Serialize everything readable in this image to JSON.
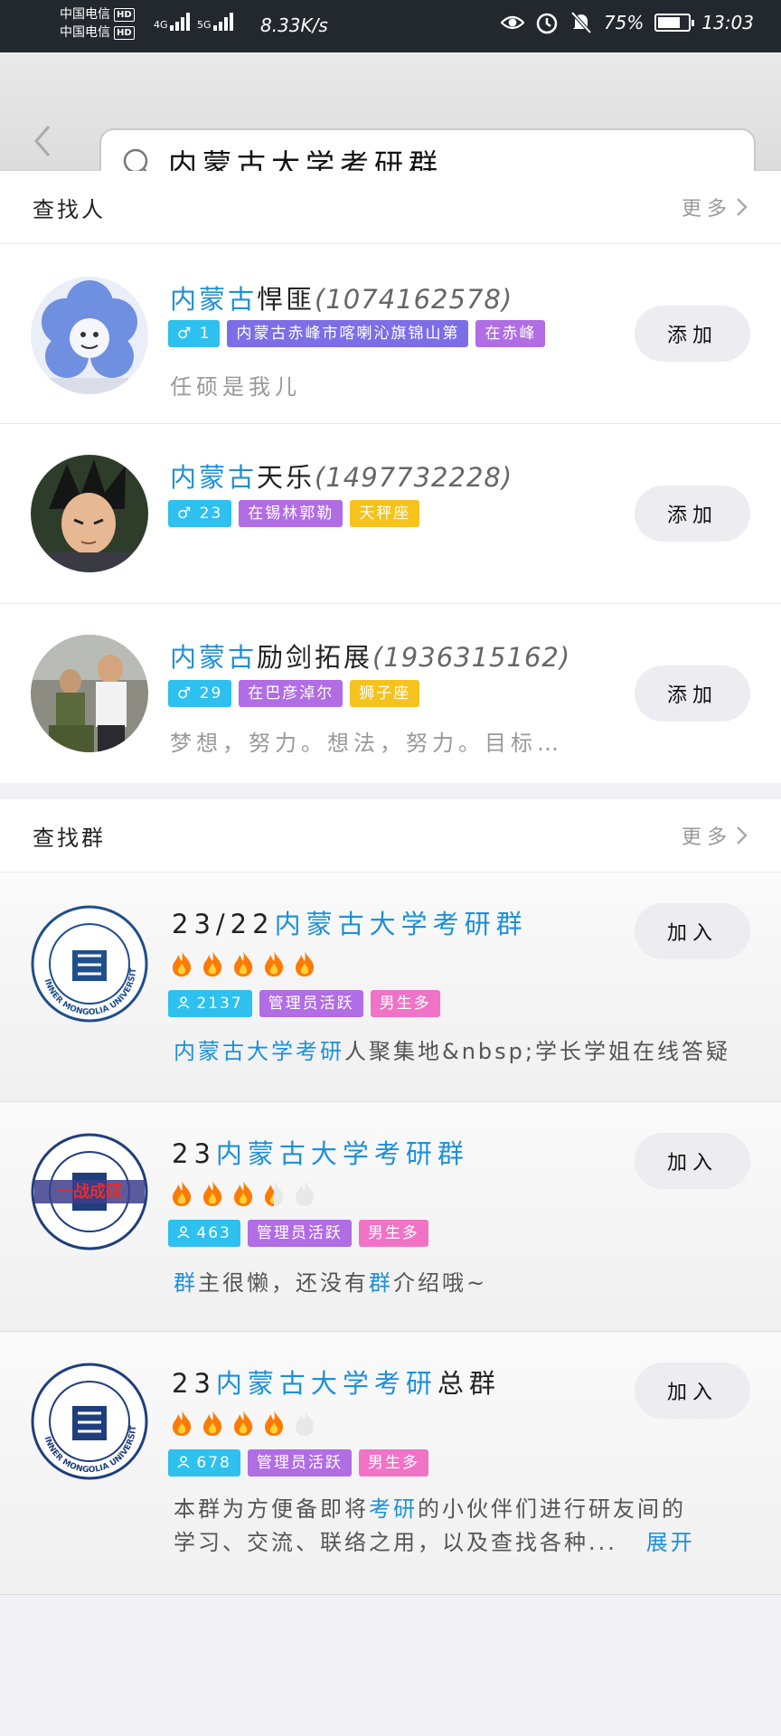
{
  "status": {
    "carrier1": "中国电信",
    "carrier2": "中国电信",
    "hd": "HD",
    "net1": "4G",
    "net2": "5G",
    "speed": "8.33K/s",
    "battery": "75%",
    "battery_level": 0.75,
    "time": "13:03"
  },
  "search": {
    "query": "内蒙古大学考研群"
  },
  "people": {
    "title": "查找人",
    "more": "更多",
    "items": [
      {
        "name_hl": "内蒙古",
        "name_rest": "悍匪",
        "qq": "(1074162578)",
        "age": "1",
        "tags": [
          "内蒙古赤峰市喀喇沁旗锦山第",
          "在赤峰"
        ],
        "desc": "任硕是我儿",
        "button": "添加"
      },
      {
        "name_hl": "内蒙古",
        "name_rest": "天乐",
        "qq": "(1497732228)",
        "age": "23",
        "tags": [
          "在锡林郭勒",
          "天秤座"
        ],
        "desc": "",
        "button": "添加"
      },
      {
        "name_hl": "内蒙古",
        "name_rest": "励剑拓展",
        "qq": "(1936315162)",
        "age": "29",
        "tags": [
          "在巴彦淖尔",
          "狮子座"
        ],
        "desc": "梦想，努力。想法，努力。目标…",
        "button": "添加"
      }
    ]
  },
  "groups": {
    "title": "查找群",
    "more": "更多",
    "items": [
      {
        "prefix": "23/22",
        "name_hl": "内蒙古大学考研群",
        "suffix": "",
        "heat": 5,
        "members": "2137",
        "tag1": "管理员活跃",
        "tag2": "男生多",
        "desc_hl": "内蒙古大学考研",
        "desc_rest": "人聚集地&nbsp;学长学姐在线答疑",
        "button": "加入"
      },
      {
        "prefix": "23",
        "name_hl": "内蒙古大学考研群",
        "suffix": "",
        "heat": 3.5,
        "members": "463",
        "tag1": "管理员活跃",
        "tag2": "男生多",
        "desc_hl1": "群",
        "desc_mid": "主很懒，还没有",
        "desc_hl2": "群",
        "desc_rest": "介绍哦~",
        "logo_stamp": "一战成硕",
        "button": "加入"
      },
      {
        "prefix": "23",
        "name_hl": "内蒙古大学考研",
        "suffix": "总群",
        "heat": 4,
        "members": "678",
        "tag1": "管理员活跃",
        "tag2": "男生多",
        "desc_line1_a": "本群为方便备即将",
        "desc_line1_hl": "考研",
        "desc_line1_b": "的小伙伴们进行研友间的",
        "desc_line2": "学习、交流、联络之用，以及查找各种...",
        "expand": "展开",
        "button": "加入"
      }
    ],
    "logo_text": "INNER MONGOLIA UNIVERSITY"
  },
  "colors": {
    "highlight": "#1e90d8",
    "tag_blue": "#2ec0ef",
    "tag_purple": "#b16de4",
    "tag_yellow": "#f6c21d",
    "tag_pink": "#f073c6",
    "flame": "#ff7a00"
  }
}
